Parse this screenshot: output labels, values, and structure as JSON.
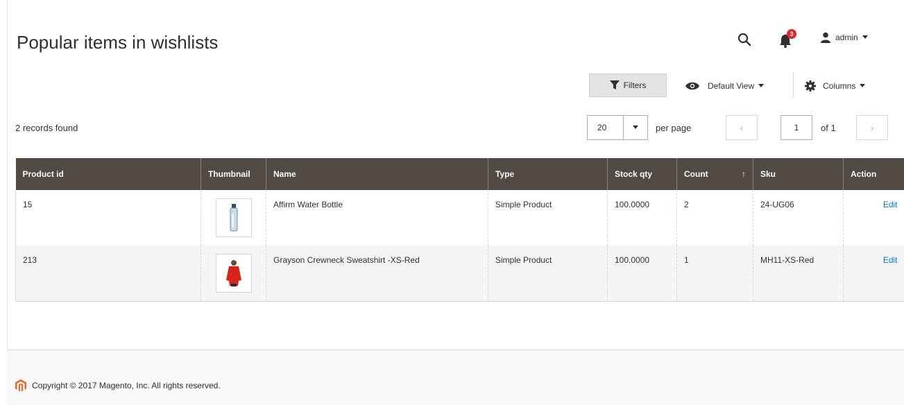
{
  "page": {
    "title": "Popular items in wishlists"
  },
  "header": {
    "notification_count": "3",
    "user_name": "admin"
  },
  "toolbar": {
    "filters_label": "Filters",
    "view_label": "Default View",
    "columns_label": "Columns"
  },
  "records_found": "2 records found",
  "pager": {
    "per_page_value": "20",
    "per_page_label": "per page",
    "current_page": "1",
    "of_label": "of 1"
  },
  "grid": {
    "columns": [
      "Product id",
      "Thumbnail",
      "Name",
      "Type",
      "Stock qty",
      "Count",
      "Sku",
      "Action"
    ],
    "sort_indicator": "↑",
    "rows": [
      {
        "product_id": "15",
        "thumbnail": "water-bottle",
        "name": "Affirm Water Bottle",
        "type": "Simple Product",
        "stock_qty": "100.0000",
        "count": "2",
        "sku": "24-UG06",
        "action": "Edit"
      },
      {
        "product_id": "213",
        "thumbnail": "red-sweatshirt",
        "name": "Grayson Crewneck Sweatshirt -XS-Red",
        "type": "Simple Product",
        "stock_qty": "100.0000",
        "count": "1",
        "sku": "MH11-XS-Red",
        "action": "Edit"
      }
    ]
  },
  "footer": {
    "copyright": "Copyright © 2017 Magento, Inc. All rights reserved."
  },
  "colors": {
    "header_bg": "#514943",
    "link": "#007bdb",
    "badge": "#e22626",
    "brand": "#f26322"
  }
}
